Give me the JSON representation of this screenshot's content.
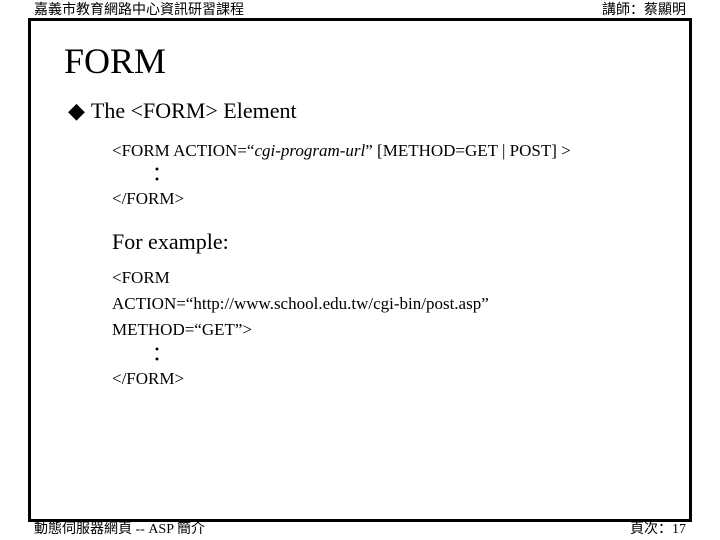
{
  "header": {
    "left": "嘉義市教育網路中心資訊研習課程",
    "right": "講師：蔡顯明"
  },
  "title": "FORM",
  "bullet": {
    "marker": "◆",
    "text": "The <FORM> Element"
  },
  "syntax": {
    "open_pre": "<FORM  ACTION=“",
    "open_italic": "cgi-program-url",
    "open_post": "”  [METHOD=GET | POST] >",
    "dots": "：",
    "close": "</FORM>"
  },
  "example_label": "For example:",
  "example": {
    "line1": "<FORM",
    "line2": "ACTION=“http://www.school.edu.tw/cgi-bin/post.asp”",
    "line3": "METHOD=“GET”>",
    "dots": "：",
    "close": "</FORM>"
  },
  "footer": {
    "left": "動態伺服器網頁 -- ASP 簡介",
    "right_label": "頁次：",
    "page": "17"
  }
}
